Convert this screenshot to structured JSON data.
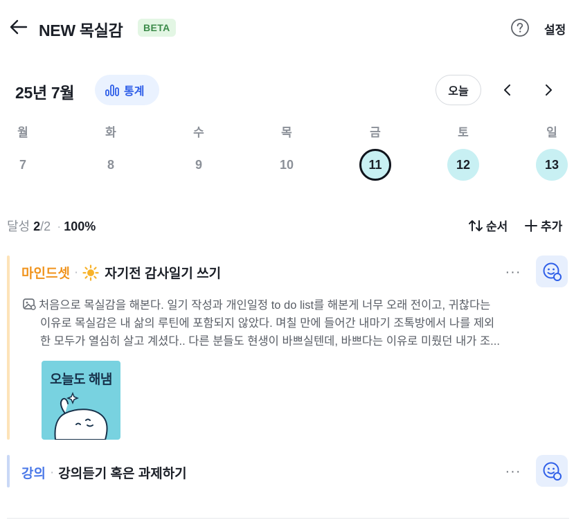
{
  "header": {
    "title": "NEW 목실감",
    "badge": "BETA",
    "settings_label": "설정",
    "back_icon": "arrow-left-icon",
    "help_icon": "question-circle-icon"
  },
  "calendar": {
    "month_label": "25년 7월",
    "stats_label": "통계",
    "today_label": "오늘",
    "weekdays": [
      "월",
      "화",
      "수",
      "목",
      "금",
      "토",
      "일"
    ],
    "days": [
      "7",
      "8",
      "9",
      "10",
      "11",
      "12",
      "13"
    ],
    "selected_day": "11",
    "completed_days": [
      "11",
      "12",
      "13"
    ]
  },
  "summary": {
    "label": "달성",
    "done": "2",
    "total": "/2",
    "separator": "·",
    "percent": "100%",
    "order_label": "순서",
    "add_label": "추가"
  },
  "tasks": [
    {
      "category": "마인드셋",
      "separator": "·",
      "icon": "sun-icon",
      "title": "자기전 감사일기 쓰기",
      "memo_lines": [
        "처음으로 목실감을 해본다. 일기 작성과 개인일정 to do list를 해본게 너무 오래 전이고, 귀찮다는",
        "이유로 목실감은 내 삶의 루틴에 포함되지 않았다. 며칠 만에 들어간 내마기 조톡방에서 나를 제외",
        "한 모두가 열심히 살고 계셨다.. 다른 분들도 현생이 바쁘실텐데, 바쁘다는 이유로 미뤘던 내가 조..."
      ],
      "sticker_text": "오늘도 해냄",
      "more": "···"
    },
    {
      "category": "강의",
      "separator": "·",
      "title": "강의듣기 혹은 과제하기",
      "more": "···"
    }
  ],
  "colors": {
    "accent_blue": "#2e5ee8",
    "done_cyan": "#c8f0f3",
    "orange": "#f0931c",
    "beta_green": "#3b8a49"
  }
}
